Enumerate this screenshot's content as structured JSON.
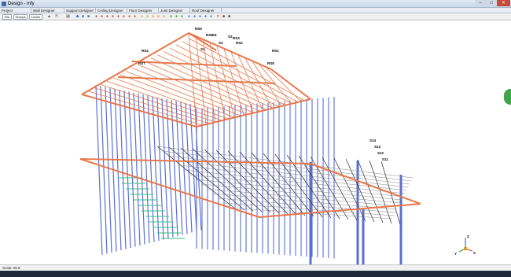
{
  "window": {
    "title": "Design - mfy",
    "minimize_icon": "minimize-icon",
    "maximize_icon": "maximize-icon",
    "close_icon": "close-icon"
  },
  "tabs": [
    {
      "label": "Project"
    },
    {
      "label": "Wall Designer"
    },
    {
      "label": "Support Designer"
    },
    {
      "label": "Ceiling Designer"
    },
    {
      "label": "Floor Designer"
    },
    {
      "label": "Joist Designer"
    },
    {
      "label": "Roof Designer"
    }
  ],
  "toolbar": {
    "file_label": "File",
    "groups_label": "Groups",
    "levels_label": "Levels"
  },
  "roof_labels": [
    "RS5",
    "RS6",
    "RS4",
    "RS1",
    "RS7",
    "RS8",
    "RS2",
    "RS3",
    "S4",
    "S2",
    "S3",
    "S1"
  ],
  "floor_labels": [
    "S14",
    "S13",
    "S12",
    "S11"
  ],
  "colors": {
    "frame": "#5a6fd6",
    "roof_truss": "#e8784a",
    "floor_joist": "#2a2a2a",
    "accent_green": "#3fa64a"
  },
  "status": {
    "scale": "Scale: 65.8"
  },
  "axis": {
    "x_label": "X",
    "y_label": "Y",
    "z_label": "Z"
  }
}
